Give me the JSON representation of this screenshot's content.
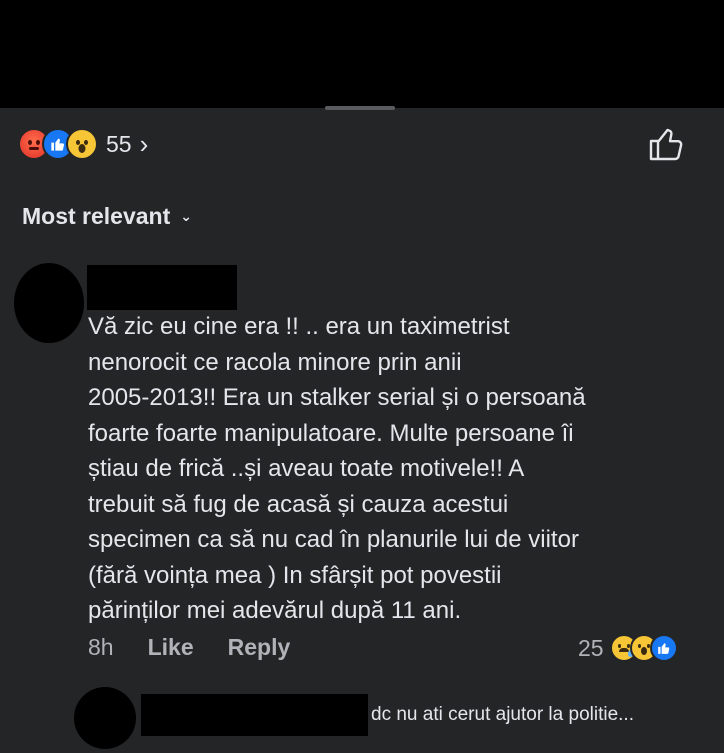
{
  "reactions": {
    "count": "55",
    "chevron": "›",
    "types": [
      "angry-reaction-icon",
      "like-reaction-icon",
      "wow-reaction-icon"
    ]
  },
  "sort": {
    "label": "Most relevant",
    "caret": "⌄"
  },
  "comment": {
    "text": "Vă zic eu cine era !! .. era un taximetrist\nnenorocit ce racola minore  prin anii\n2005-2013!! Era un stalker serial și o persoană\nfoarte foarte manipulatoare. Multe persoane îi\nștiau de frică ..și aveau toate motivele!! A\ntrebuit să fug de acasă și cauza acestui\nspecimen ca să nu cad în planurile lui de viitor\n(fără voința mea ) In sfârșit pot povestii\npărinților mei adevărul după 11 ani.",
    "time": "8h",
    "like_label": "Like",
    "reply_label": "Reply",
    "reaction_count": "25"
  },
  "reply": {
    "preview": "dc nu ati cerut ajutor la politie..."
  },
  "colors": {
    "background": "#242526",
    "text": "#e4e6eb",
    "muted": "#b0b3b8",
    "like_blue": "#1877f2",
    "wow_yellow": "#f7c637"
  }
}
